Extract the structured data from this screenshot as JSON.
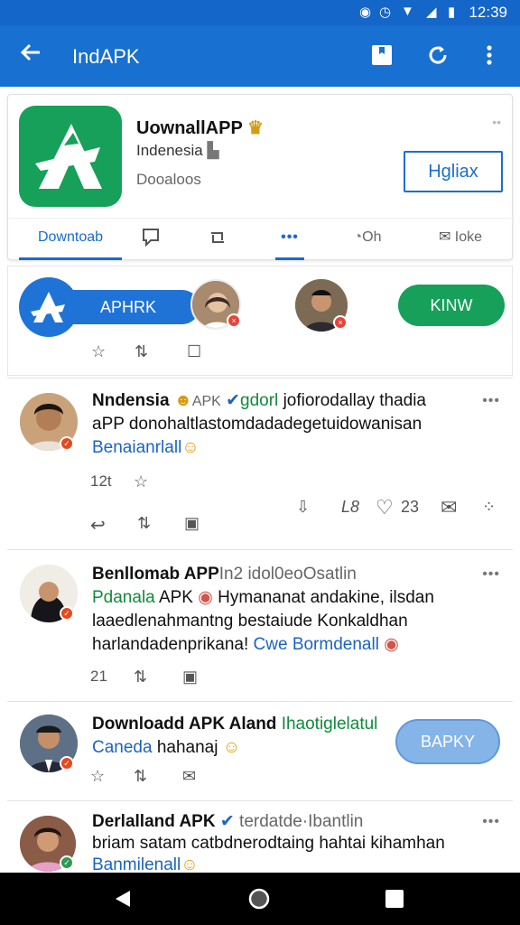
{
  "status_bar": {
    "time": "12:39"
  },
  "app_bar": {
    "title": "IndAPK"
  },
  "app_card": {
    "name": "UownallAPP",
    "region": "Indenesia",
    "subtitle": "Dooaloos",
    "more": "••",
    "install_label": "Hgliax",
    "tabs": [
      {
        "label": "Downtoab",
        "active": true
      },
      {
        "label": "",
        "icon": "chat-bubble-icon"
      },
      {
        "label": "",
        "icon": "repost-icon"
      },
      {
        "label": "•••",
        "active": true
      },
      {
        "label": "Oh"
      },
      {
        "label": "Ioke",
        "icon": "mail-icon"
      }
    ]
  },
  "story": {
    "apk_label": "APHRK",
    "new_button": "KINW"
  },
  "posts": [
    {
      "author": "Nndensia",
      "handle": "APK",
      "tail": "gdorl",
      "tail2": "jofiorodallay thadia",
      "line2": "aPP donohaltlastomdadadegetuidowanisan",
      "line3": "Benaianrlall",
      "count": "12t",
      "stats": [
        "L8",
        "23"
      ]
    },
    {
      "author": "Benllomab APP",
      "tail": "In2 idol0eoOsatlin",
      "line2_green": "Pdanala",
      "line2_rest": " APK ",
      "line2_tail": "Hymananat andakine, ilsdan",
      "line3": "laaedlenahmantng bestaiude Konkaldhan",
      "line4": "harlandadenprikana!",
      "line4_blue": "Cwe Bormdenall",
      "count": "21"
    },
    {
      "author": "Downloadd APK Aland",
      "tail": "Ihaotiglelatul",
      "line2_blue": "Caneda",
      "line2_rest": "hahanaj",
      "fab": "BAPKY"
    },
    {
      "author": "Derlalland APK",
      "tail": "terdatde·Ibantlin",
      "line2": "briam satam catbdnerodtaing hahtai kihamhan",
      "line3": "Banmilenall"
    }
  ]
}
